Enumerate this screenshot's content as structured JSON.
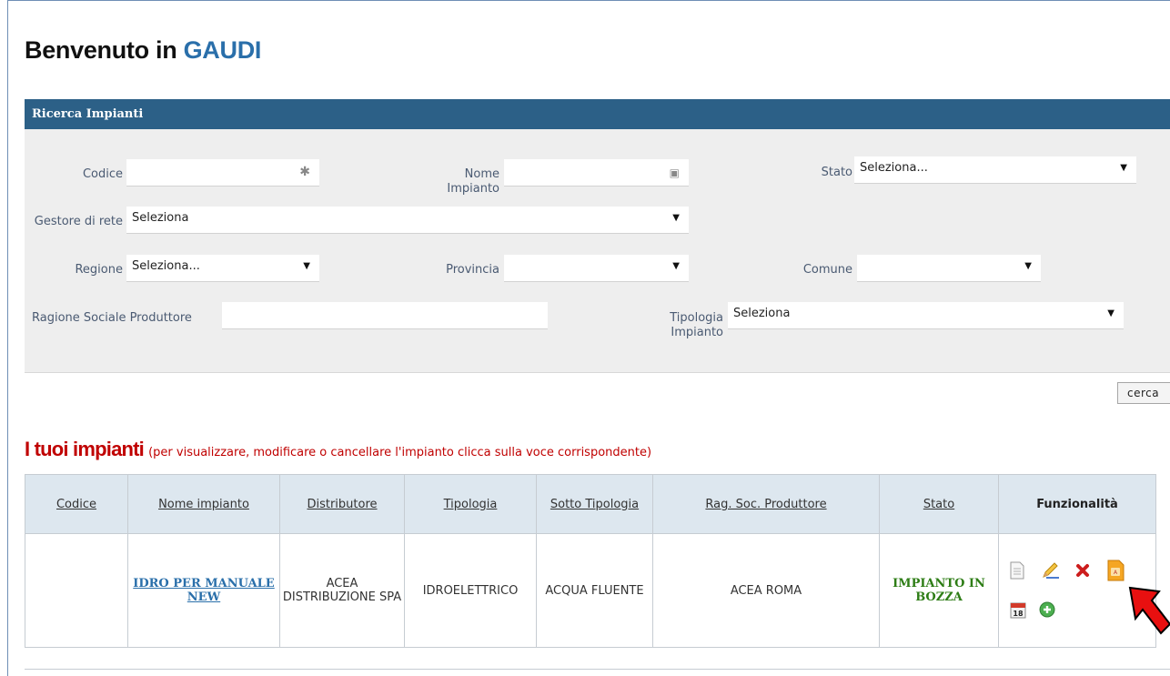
{
  "page": {
    "title_prefix": "Benvenuto in ",
    "title_brand": "GAUDI"
  },
  "search": {
    "header": "Ricerca Impianti",
    "codice_label": "Codice",
    "codice_value": "",
    "nome_label": "Nome Impianto",
    "nome_value": "",
    "stato_label": "Stato",
    "stato_value": "Seleziona...",
    "gestore_label": "Gestore di rete",
    "gestore_value": "Seleziona",
    "regione_label": "Regione",
    "regione_value": "Seleziona...",
    "provincia_label": "Provincia",
    "provincia_value": "",
    "comune_label": "Comune",
    "comune_value": "",
    "ragione_label": "Ragione Sociale Produttore",
    "ragione_value": "",
    "tipologia_label": "Tipologia Impianto",
    "tipologia_value": "Seleziona",
    "cerca_label": "cerca"
  },
  "impianti": {
    "title": "I tuoi impianti",
    "subtitle": "(per visualizzare, modificare o cancellare l'impianto clicca sulla voce corrispondente)",
    "columns": [
      "Codice",
      "Nome impianto",
      "Distributore",
      "Tipologia",
      "Sotto Tipologia",
      "Rag. Soc. Produttore",
      "Stato",
      "Funzionalità"
    ],
    "rows": [
      {
        "codice": "",
        "nome": "IDRO PER MANUALE NEW",
        "distributore": "ACEA DISTRIBUZIONE SPA",
        "tipologia": "IDROELETTRICO",
        "sotto_tipologia": "ACQUA FLUENTE",
        "produttore": "ACEA ROMA",
        "stato": "IMPIANTO IN BOZZA",
        "calendar_day": "18"
      }
    ]
  },
  "icons": {
    "view": "document-icon",
    "edit": "pencil-icon",
    "delete": "delete-x-icon",
    "pdf": "pdf-file-icon",
    "calendar": "calendar-icon",
    "add": "add-circle-icon",
    "pointer": "red-arrow-icon"
  },
  "colors": {
    "header_bar": "#2c6087",
    "brand": "#2a6faa",
    "section_title": "#c00000",
    "status_green": "#2e7d16"
  }
}
